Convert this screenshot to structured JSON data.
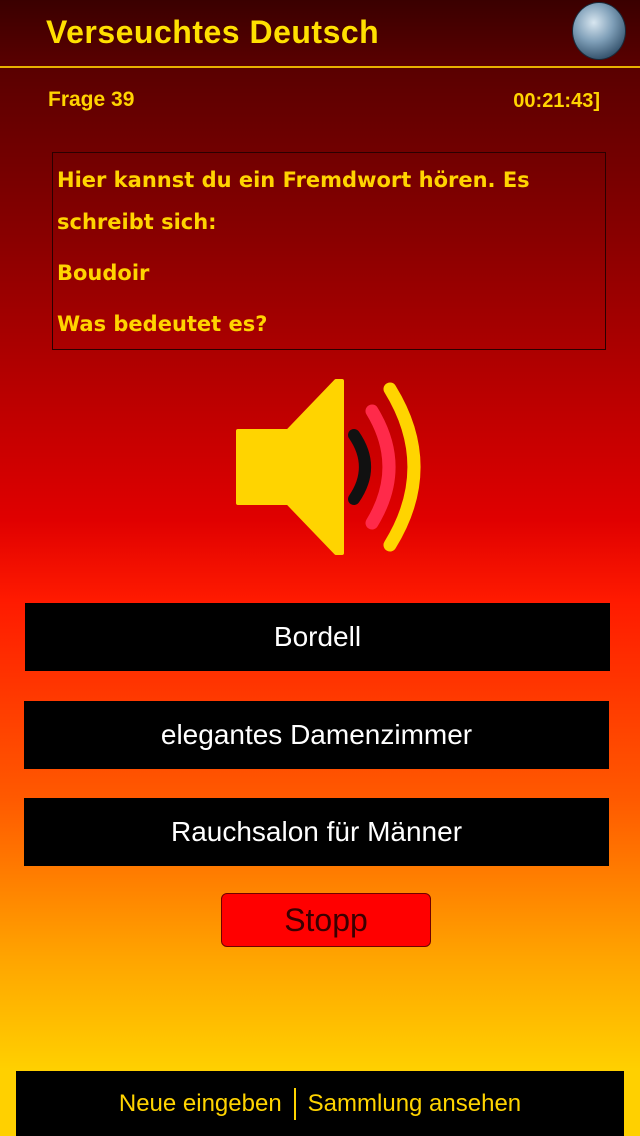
{
  "header": {
    "title": "Verseuchtes Deutsch"
  },
  "status": {
    "question_number": "Frage 39",
    "timer": "00:21:43]"
  },
  "question": {
    "line1": "Hier kannst du ein Fremdwort hören. Es schreibt sich:",
    "word": "Boudoir",
    "prompt": "Was bedeutet es?"
  },
  "speaker": {
    "icon": "speaker-icon"
  },
  "answers": [
    {
      "label": "Bordell"
    },
    {
      "label": "elegantes Damenzimmer"
    },
    {
      "label": "Rauchsalon für Männer"
    }
  ],
  "stop_label": "Stopp",
  "footer": {
    "new_label": "Neue eingeben",
    "collection_label": "Sammlung ansehen"
  },
  "colors": {
    "accent": "#ffd400",
    "stop": "#ff0000",
    "button_bg": "#000000"
  }
}
